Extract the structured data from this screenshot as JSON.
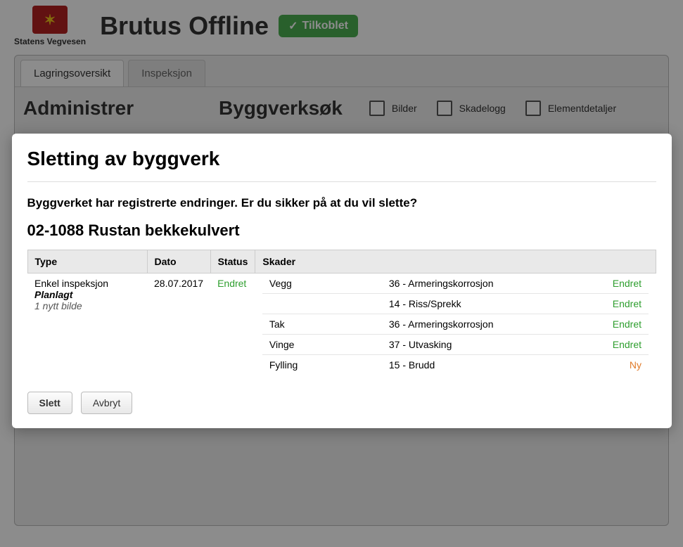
{
  "header": {
    "org": "Statens Vegvesen",
    "app_title": "Brutus Offline",
    "conn_badge": "Tilkoblet"
  },
  "tabs": [
    {
      "label": "Lagringsoversikt",
      "active": true
    },
    {
      "label": "Inspeksjon",
      "active": false
    }
  ],
  "panel": {
    "admin_title": "Administrer",
    "search_title": "Byggverksøk",
    "checkboxes": [
      {
        "label": "Bilder"
      },
      {
        "label": "Skadelogg"
      },
      {
        "label": "Elementdetaljer"
      }
    ]
  },
  "modal": {
    "title": "Sletting av byggverk",
    "warning": "Byggverket har registrerte endringer. Er du sikker på at du vil slette?",
    "subtitle": "02-1088 Rustan bekkekulvert",
    "columns": {
      "type": "Type",
      "dato": "Dato",
      "status": "Status",
      "skader": "Skader"
    },
    "row": {
      "type_main": "Enkel inspeksjon",
      "type_sub": "Planlagt",
      "type_note": "1 nytt bilde",
      "dato": "28.07.2017",
      "status": "Endret",
      "skader": [
        {
          "element": "Vegg",
          "code": "36 - Armeringskorrosjon",
          "status": "Endret",
          "cls": "endret",
          "showElement": true
        },
        {
          "element": "",
          "code": "14 - Riss/Sprekk",
          "status": "Endret",
          "cls": "endret",
          "showElement": false
        },
        {
          "element": "Tak",
          "code": "36 - Armeringskorrosjon",
          "status": "Endret",
          "cls": "endret",
          "showElement": true
        },
        {
          "element": "Vinge",
          "code": "37 - Utvasking",
          "status": "Endret",
          "cls": "endret",
          "showElement": true
        },
        {
          "element": "Fylling",
          "code": "15 - Brudd",
          "status": "Ny",
          "cls": "ny",
          "showElement": true
        }
      ]
    },
    "buttons": {
      "delete": "Slett",
      "cancel": "Avbryt"
    }
  }
}
